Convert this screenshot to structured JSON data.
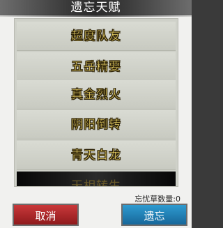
{
  "dialog": {
    "title": "遗忘天赋",
    "talents": [
      {
        "label": "超度队友"
      },
      {
        "label": "五岳精要"
      },
      {
        "label": "真金烈火"
      },
      {
        "label": "阴阳倒转"
      },
      {
        "label": "青天白龙"
      },
      {
        "label": "天相转生"
      }
    ],
    "herb_count": "忘忧草数量:0",
    "cancel_label": "取消",
    "confirm_label": "遗忘"
  }
}
